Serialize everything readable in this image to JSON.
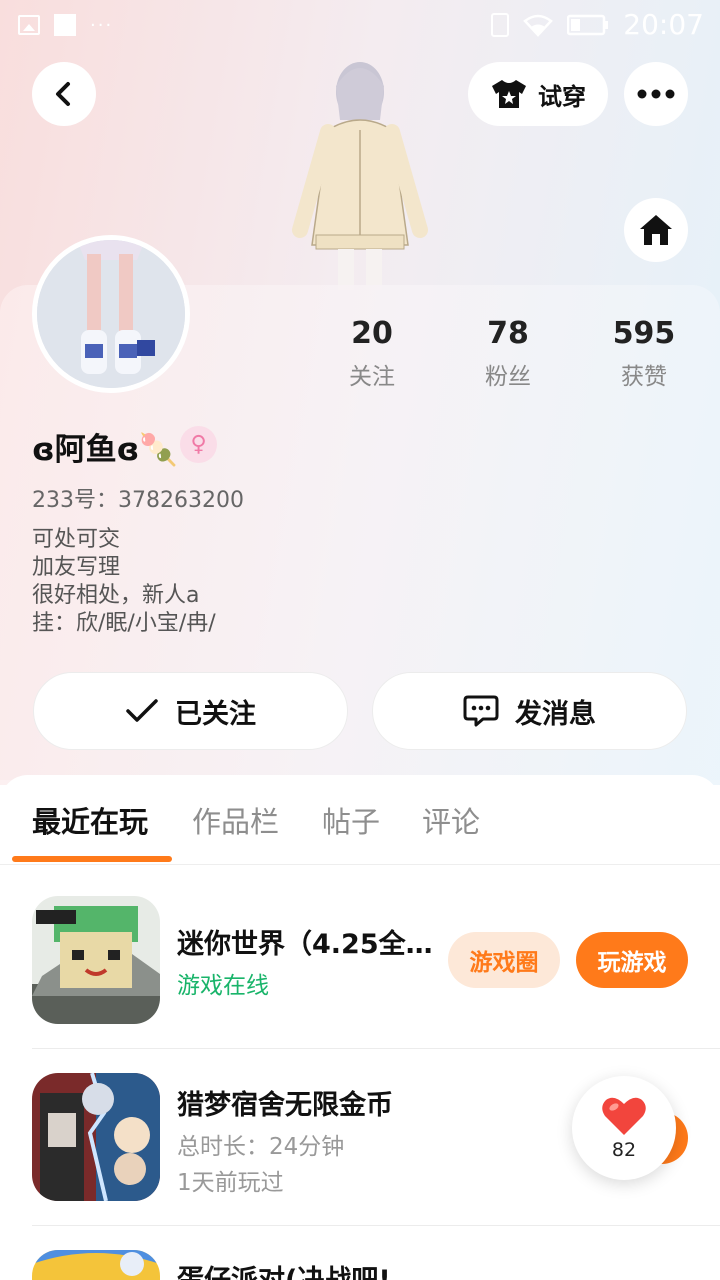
{
  "status_bar": {
    "time": "20:07",
    "dots": "···"
  },
  "header": {
    "try_on_label": "试穿"
  },
  "profile": {
    "username": "ɞ阿鱼ɞ🍡",
    "gender_symbol": "♀",
    "uid": "233号：378263200",
    "bio": [
      "可处可交",
      "加友写理",
      "很好相处，新人a",
      "挂：欣/眠/小宝/冉/"
    ]
  },
  "stats": [
    {
      "value": "20",
      "label": "关注"
    },
    {
      "value": "78",
      "label": "粉丝"
    },
    {
      "value": "595",
      "label": "获赞"
    }
  ],
  "actions": {
    "follow_label": "已关注",
    "message_label": "发消息"
  },
  "tabs": [
    "最近在玩",
    "作品栏",
    "帖子",
    "评论"
  ],
  "games": [
    {
      "title": "迷你世界（4.25全…",
      "sub": "游戏在线",
      "circle_label": "游戏圈",
      "play_label": "玩游戏"
    },
    {
      "title": "猎梦宿舍无限金币",
      "duration": "总时长：24分钟",
      "last_played": "1天前玩过"
    },
    {
      "title": "蛋仔派对(决战吧!"
    }
  ],
  "like_float": {
    "count": "82"
  },
  "colors": {
    "accent": "#ff7a1a",
    "online": "#19b46a",
    "gender": "#f07aa6"
  }
}
